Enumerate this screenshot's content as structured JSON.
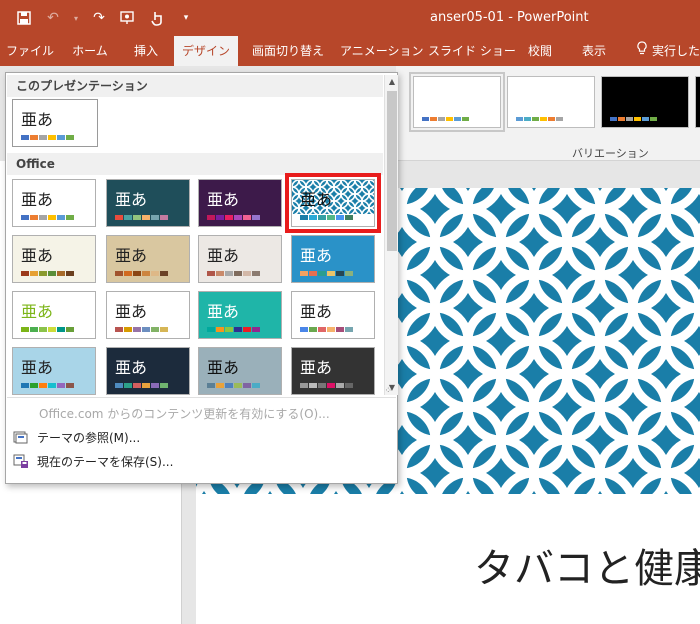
{
  "window": {
    "title": "anser05-01 - PowerPoint"
  },
  "qat": {
    "icons": [
      "save-icon",
      "undo-icon",
      "redo-icon",
      "present-icon",
      "touch-mode-icon",
      "customize-icon"
    ]
  },
  "tabs": [
    {
      "label": "ファイル",
      "active": false
    },
    {
      "label": "ホーム",
      "active": false
    },
    {
      "label": "挿入",
      "active": false
    },
    {
      "label": "デザイン",
      "active": true
    },
    {
      "label": "画面切り替え",
      "active": false
    },
    {
      "label": "アニメーション",
      "active": false
    },
    {
      "label": "スライド ショー",
      "active": false
    },
    {
      "label": "校閲",
      "active": false
    },
    {
      "label": "表示",
      "active": false
    }
  ],
  "tell_me": {
    "label": "実行したい"
  },
  "variations": {
    "label": "バリエーション"
  },
  "gallery": {
    "section_current": "このプレゼンテーション",
    "section_office": "Office",
    "theme_sample": "亜あ",
    "footer": {
      "enable_updates": "Office.com からのコンテンツ更新を有効にする(O)...",
      "browse_themes": "テーマの参照(M)...",
      "save_theme": "現在のテーマを保存(S)..."
    }
  },
  "slide": {
    "title": "タバコと健康"
  },
  "colors": {
    "accent": "#b7472a",
    "highlight": "#e81c1c",
    "slide_blue": "#1a7ea8"
  }
}
